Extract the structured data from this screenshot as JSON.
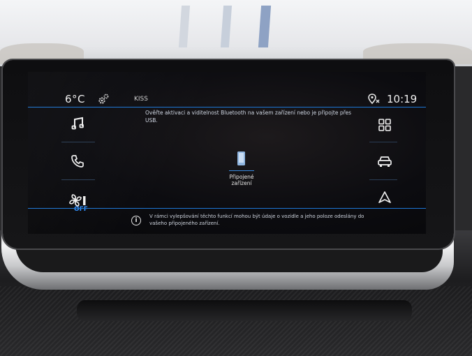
{
  "status_bar": {
    "temperature": "6°C",
    "settings_icon": "gear-icon",
    "source": "KISS",
    "nav_icon": "location-pin-icon",
    "time": "10:19"
  },
  "left_menu": [
    {
      "icon": "music-note-icon"
    },
    {
      "icon": "phone-icon"
    },
    {
      "icon": "fan-icon",
      "label": "OFF"
    }
  ],
  "right_menu": [
    {
      "icon": "apps-grid-icon"
    },
    {
      "icon": "car-icon"
    },
    {
      "icon": "navigation-arrow-icon"
    }
  ],
  "main": {
    "notice": "Ověřte aktivaci a viditelnost Bluetooth na vašem zařízení nebo je připojte přes USB.",
    "device_label_line1": "Připojené",
    "device_label_line2": "zařízení"
  },
  "info_bar": {
    "text": "V rámci vylepšování těchto funkcí mohou být údaje o vozidle a jeho poloze odeslány do vašeho připojeného zařízení."
  },
  "colors": {
    "accent": "#1d77d6",
    "off_label": "#2f8fff"
  }
}
